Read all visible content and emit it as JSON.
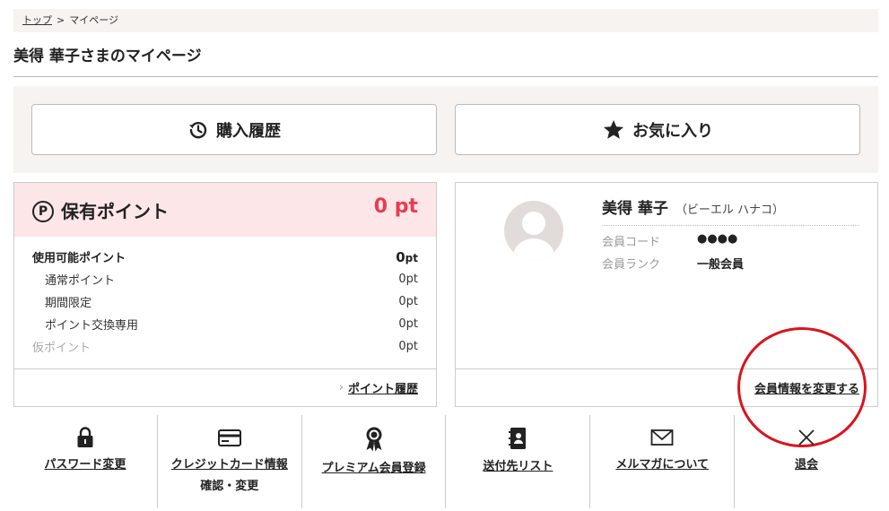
{
  "breadcrumb": {
    "home": "トップ",
    "separator": ">",
    "current": "マイページ"
  },
  "page_title": "美得 華子さまのマイページ",
  "top_buttons": {
    "history": "購入履歴",
    "favorites": "お気に入り"
  },
  "points": {
    "title": "保有ポイント",
    "icon_letter": "P",
    "total": "0 pt",
    "usable_label": "使用可能ポイント",
    "usable_value": "0",
    "usable_unit": "pt",
    "rows": [
      {
        "label": "通常ポイント",
        "value": "0pt"
      },
      {
        "label": "期間限定",
        "value": "0pt"
      },
      {
        "label": "ポイント交換専用",
        "value": "0pt"
      }
    ],
    "temp_label": "仮ポイント",
    "temp_value": "0pt",
    "history_link": "ポイント履歴"
  },
  "member": {
    "name": "美得 華子",
    "kana": "（ビーエル ハナコ）",
    "code_label": "会員コード",
    "code_value": "●●●●",
    "rank_label": "会員ランク",
    "rank_value": "一般会員",
    "edit_link": "会員情報を変更する"
  },
  "nav": {
    "password": "パスワード変更",
    "credit_line1": "クレジットカード情報",
    "credit_line2": "確認・変更",
    "premium": "プレミアム会員登録",
    "address": "送付先リスト",
    "newsletter": "メルマガについて",
    "withdraw": "退会"
  },
  "colors": {
    "accent_red": "#e83c52",
    "panel_bg": "#f6f3f0",
    "points_head_bg": "#fde6e8",
    "annotation_circle": "#d9141e"
  }
}
